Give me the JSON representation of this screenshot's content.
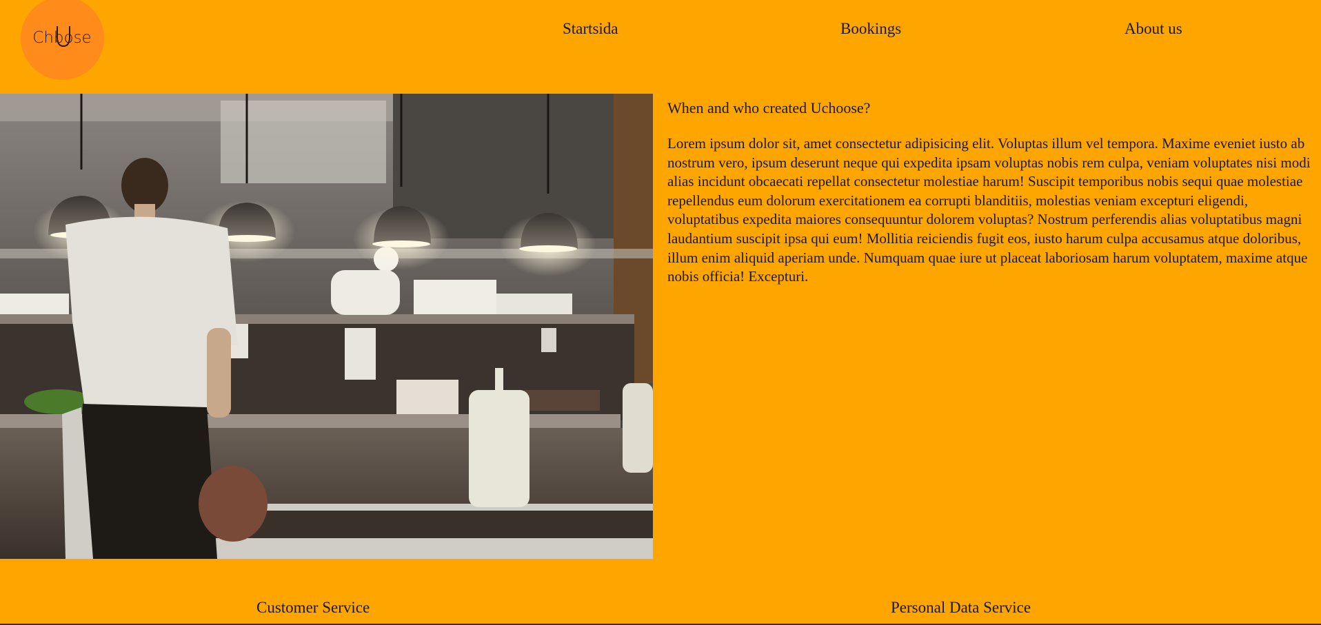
{
  "header": {
    "logo_text": "Chbose",
    "nav": {
      "startsida": "Startsida",
      "bookings": "Bookings",
      "about": "About us"
    }
  },
  "main": {
    "image_icon": "restaurant-kitchen-photo",
    "title": "When and who created Uchoose?",
    "body": "Lorem ipsum dolor sit, amet consectetur adipisicing elit. Voluptas illum vel tempora. Maxime eveniet iusto ab nostrum vero, ipsum deserunt neque qui expedita ipsam voluptas nobis rem culpa, veniam voluptates nisi modi alias incidunt obcaecati repellat consectetur molestiae harum! Suscipit temporibus nobis sequi quae molestiae repellendus eum dolorum exercitationem ea corrupti blanditiis, molestias veniam excepturi eligendi, voluptatibus expedita maiores consequuntur dolorem voluptas? Nostrum perferendis alias voluptatibus magni laudantium suscipit ipsa qui eum! Mollitia reiciendis fugit eos, iusto harum culpa accusamus atque doloribus, illum enim aliquid aperiam unde. Numquam quae iure ut placeat laboriosam harum voluptatem, maxime atque nobis officia! Excepturi."
  },
  "footer": {
    "customer_service": "Customer Service",
    "personal_data_service": "Personal Data Service"
  },
  "colors": {
    "background": "#FFA500",
    "logo_circle": "#FF8C1A"
  }
}
